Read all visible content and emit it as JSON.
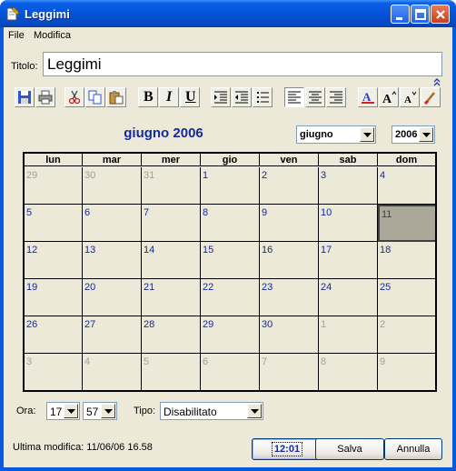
{
  "window": {
    "title": "Leggimi"
  },
  "menu": [
    "File",
    "Modifica"
  ],
  "titolo": {
    "label": "Titolo:",
    "value": "Leggimi"
  },
  "toolbar": {
    "icons": [
      "save-icon",
      "print-icon",
      "cut-icon",
      "copy-icon",
      "paste-icon",
      "bold-icon",
      "italic-icon",
      "underline-icon",
      "indent-icon",
      "outdent-icon",
      "bullet-list-icon",
      "align-left-icon",
      "align-center-icon",
      "align-right-icon",
      "font-color-icon",
      "font-larger-icon",
      "font-smaller-icon",
      "clear-format-icon"
    ],
    "bold_glyph": "B",
    "italic_glyph": "I",
    "underline_glyph": "U"
  },
  "calendar": {
    "title": "giugno 2006",
    "month_select": "giugno",
    "year_select": "2006",
    "weekdays": [
      "lun",
      "mar",
      "mer",
      "gio",
      "ven",
      "sab",
      "dom"
    ],
    "weeks": [
      [
        {
          "d": "29",
          "m": "other"
        },
        {
          "d": "30",
          "m": "other"
        },
        {
          "d": "31",
          "m": "other"
        },
        {
          "d": "1",
          "m": "cur"
        },
        {
          "d": "2",
          "m": "cur"
        },
        {
          "d": "3",
          "m": "cur"
        },
        {
          "d": "4",
          "m": "cur"
        }
      ],
      [
        {
          "d": "5",
          "m": "cur"
        },
        {
          "d": "6",
          "m": "cur"
        },
        {
          "d": "7",
          "m": "cur"
        },
        {
          "d": "8",
          "m": "cur"
        },
        {
          "d": "9",
          "m": "cur"
        },
        {
          "d": "10",
          "m": "cur"
        },
        {
          "d": "11",
          "m": "today"
        }
      ],
      [
        {
          "d": "12",
          "m": "cur"
        },
        {
          "d": "13",
          "m": "cur"
        },
        {
          "d": "14",
          "m": "cur"
        },
        {
          "d": "15",
          "m": "cur"
        },
        {
          "d": "16",
          "m": "cur"
        },
        {
          "d": "17",
          "m": "cur"
        },
        {
          "d": "18",
          "m": "cur"
        }
      ],
      [
        {
          "d": "19",
          "m": "cur"
        },
        {
          "d": "20",
          "m": "cur"
        },
        {
          "d": "21",
          "m": "cur"
        },
        {
          "d": "22",
          "m": "cur"
        },
        {
          "d": "23",
          "m": "cur"
        },
        {
          "d": "24",
          "m": "cur"
        },
        {
          "d": "25",
          "m": "cur"
        }
      ],
      [
        {
          "d": "26",
          "m": "cur"
        },
        {
          "d": "27",
          "m": "cur"
        },
        {
          "d": "28",
          "m": "cur"
        },
        {
          "d": "29",
          "m": "cur"
        },
        {
          "d": "30",
          "m": "cur"
        },
        {
          "d": "1",
          "m": "other"
        },
        {
          "d": "2",
          "m": "other"
        }
      ],
      [
        {
          "d": "3",
          "m": "other"
        },
        {
          "d": "4",
          "m": "other"
        },
        {
          "d": "5",
          "m": "other"
        },
        {
          "d": "6",
          "m": "other"
        },
        {
          "d": "7",
          "m": "other"
        },
        {
          "d": "8",
          "m": "other"
        },
        {
          "d": "9",
          "m": "other"
        }
      ]
    ]
  },
  "ora": {
    "label": "Ora:",
    "hour": "17",
    "minute": "57"
  },
  "tipo": {
    "label": "Tipo:",
    "value": "Disabilitato"
  },
  "footer": {
    "last_modified": "Ultima modifica: 11/06/06 16.58",
    "clock_button": "12:01",
    "save_button": "Salva",
    "cancel_button": "Annulla"
  }
}
